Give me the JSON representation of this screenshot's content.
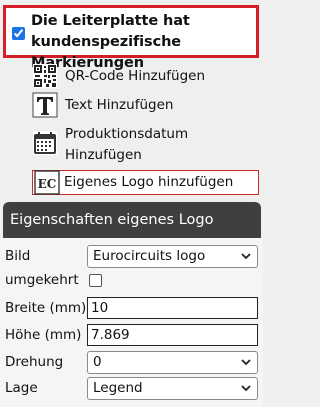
{
  "custom_markings": {
    "checked": true,
    "label_line1": "Die Leiterplatte hat",
    "label_line2": "kundenspezifische Markierungen"
  },
  "actions": [
    {
      "label": "QR-Code Hinzufügen",
      "icon": "qr-code-icon"
    },
    {
      "label": "Text Hinzufügen",
      "icon": "text-t-icon"
    },
    {
      "label_line1": "Produktionsdatum",
      "label_line2": "Hinzufügen",
      "icon": "calendar-icon"
    },
    {
      "label": "Eigenes Logo hinzufügen",
      "icon": "ec-logo-icon",
      "icon_text": "EC",
      "highlighted": true
    }
  ],
  "section": {
    "title": "Eigenschaften eigenes Logo"
  },
  "form": {
    "bild": {
      "label": "Bild",
      "value": "Eurocircuits logo"
    },
    "umgekehrt": {
      "label": "umgekehrt",
      "checked": false
    },
    "breite": {
      "label": "Breite (mm)",
      "value": "10"
    },
    "hoehe": {
      "label": "Höhe (mm)",
      "value": "7.869"
    },
    "drehung": {
      "label": "Drehung",
      "value": "0"
    },
    "lage": {
      "label": "Lage",
      "value": "Legend"
    }
  },
  "colors": {
    "highlight_border": "#d31f25",
    "header_bg": "#3f3f3f",
    "checkbox_accent": "#1a73e8"
  }
}
